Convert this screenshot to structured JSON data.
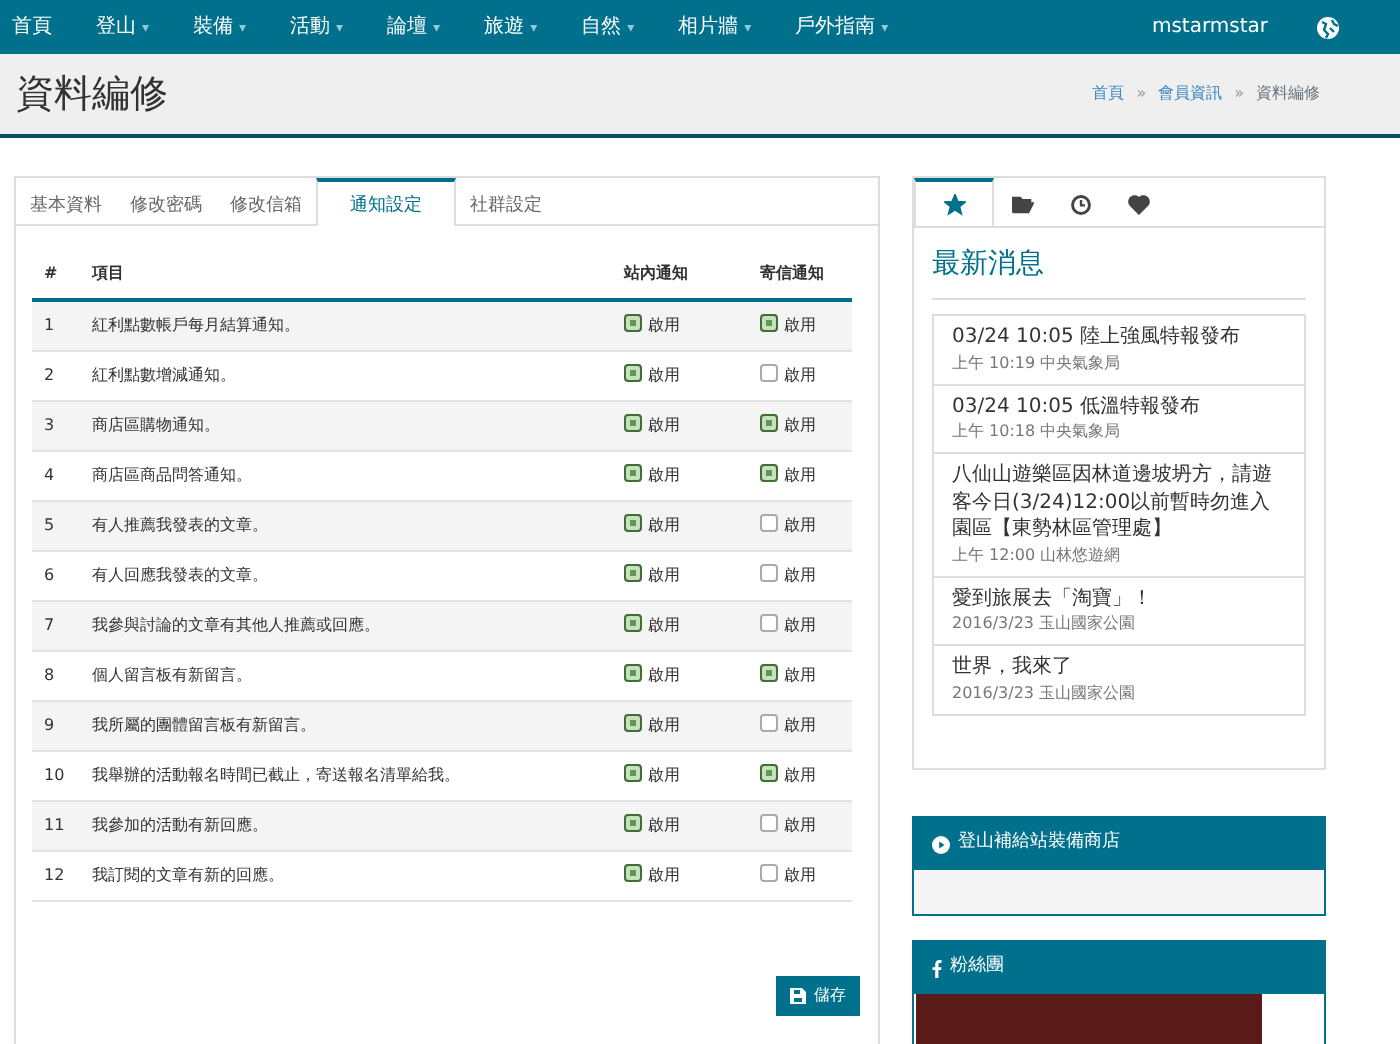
{
  "navbar": {
    "items": [
      {
        "label": "首頁"
      },
      {
        "label": "登山",
        "caret": "▾"
      },
      {
        "label": "裝備",
        "caret": "▾"
      },
      {
        "label": "活動",
        "caret": "▾"
      },
      {
        "label": "論壇",
        "caret": "▾"
      },
      {
        "label": "旅遊",
        "caret": "▾"
      },
      {
        "label": "自然",
        "caret": "▾"
      },
      {
        "label": "相片牆",
        "caret": "▾"
      },
      {
        "label": "戶外指南",
        "caret": "▾"
      }
    ],
    "user": "mstarmstar"
  },
  "page_header": {
    "title": "資料編修",
    "breadcrumb": [
      {
        "label": "首頁",
        "kind": "link"
      },
      {
        "label": "»",
        "kind": "separator"
      },
      {
        "label": "會員資訊",
        "kind": "link"
      },
      {
        "label": "»",
        "kind": "separator"
      },
      {
        "label": "資料編修",
        "kind": "current"
      }
    ]
  },
  "tabs": [
    {
      "label": "基本資料",
      "selected": false
    },
    {
      "label": "修改密碼",
      "selected": false
    },
    {
      "label": "修改信箱",
      "selected": false
    },
    {
      "label": "通知設定",
      "selected": true
    },
    {
      "label": "社群設定",
      "selected": false
    }
  ],
  "table": {
    "columns": [
      "#",
      "項目",
      "站內通知",
      "寄信通知"
    ],
    "rows": [
      {
        "no": "1",
        "item": "紅利點數帳戶每月結算通知。",
        "site": true,
        "site_label": "啟用",
        "email": true,
        "email_label": "啟用"
      },
      {
        "no": "2",
        "item": "紅利點數增減通知。",
        "site": true,
        "site_label": "啟用",
        "email": false,
        "email_label": "啟用"
      },
      {
        "no": "3",
        "item": "商店區購物通知。",
        "site": true,
        "site_label": "啟用",
        "email": true,
        "email_label": "啟用"
      },
      {
        "no": "4",
        "item": "商店區商品問答通知。",
        "site": true,
        "site_label": "啟用",
        "email": true,
        "email_label": "啟用"
      },
      {
        "no": "5",
        "item": "有人推薦我發表的文章。",
        "site": true,
        "site_label": "啟用",
        "email": false,
        "email_label": "啟用"
      },
      {
        "no": "6",
        "item": "有人回應我發表的文章。",
        "site": true,
        "site_label": "啟用",
        "email": false,
        "email_label": "啟用"
      },
      {
        "no": "7",
        "item": "我參與討論的文章有其他人推薦或回應。",
        "site": true,
        "site_label": "啟用",
        "email": false,
        "email_label": "啟用"
      },
      {
        "no": "8",
        "item": "個人留言板有新留言。",
        "site": true,
        "site_label": "啟用",
        "email": true,
        "email_label": "啟用"
      },
      {
        "no": "9",
        "item": "我所屬的團體留言板有新留言。",
        "site": true,
        "site_label": "啟用",
        "email": false,
        "email_label": "啟用"
      },
      {
        "no": "10",
        "item": "我舉辦的活動報名時間已截止，寄送報名清單給我。",
        "site": true,
        "site_label": "啟用",
        "email": true,
        "email_label": "啟用"
      },
      {
        "no": "11",
        "item": "我參加的活動有新回應。",
        "site": true,
        "site_label": "啟用",
        "email": false,
        "email_label": "啟用"
      },
      {
        "no": "12",
        "item": "我訂閱的文章有新的回應。",
        "site": true,
        "site_label": "啟用",
        "email": false,
        "email_label": "啟用"
      }
    ]
  },
  "save_button": "儲存",
  "sidebar": {
    "tabs": [
      {
        "selected": true
      },
      {
        "selected": false
      },
      {
        "selected": false
      },
      {
        "selected": false
      }
    ],
    "news_title": "最新消息",
    "news": [
      {
        "title": "03/24 10:05 陸上強風特報發布",
        "meta": "上午 10:19 中央氣象局"
      },
      {
        "title": "03/24 10:05 低溫特報發布",
        "meta": "上午 10:18 中央氣象局"
      },
      {
        "title": "八仙山遊樂區因林道邊坡坍方，請遊客今日(3/24)12:00以前暫時勿進入園區【東勢林區管理處】",
        "meta": "上午 12:00 山林悠遊網"
      },
      {
        "title": "愛到旅展去「淘寶」！",
        "meta": "2016/3/23 玉山國家公園"
      },
      {
        "title": "世界，我來了",
        "meta": "2016/3/23 玉山國家公園"
      }
    ],
    "panels": [
      {
        "kind": "shop",
        "title": "登山補給站裝備商店"
      },
      {
        "kind": "facebook",
        "title": "粉絲團"
      }
    ]
  }
}
